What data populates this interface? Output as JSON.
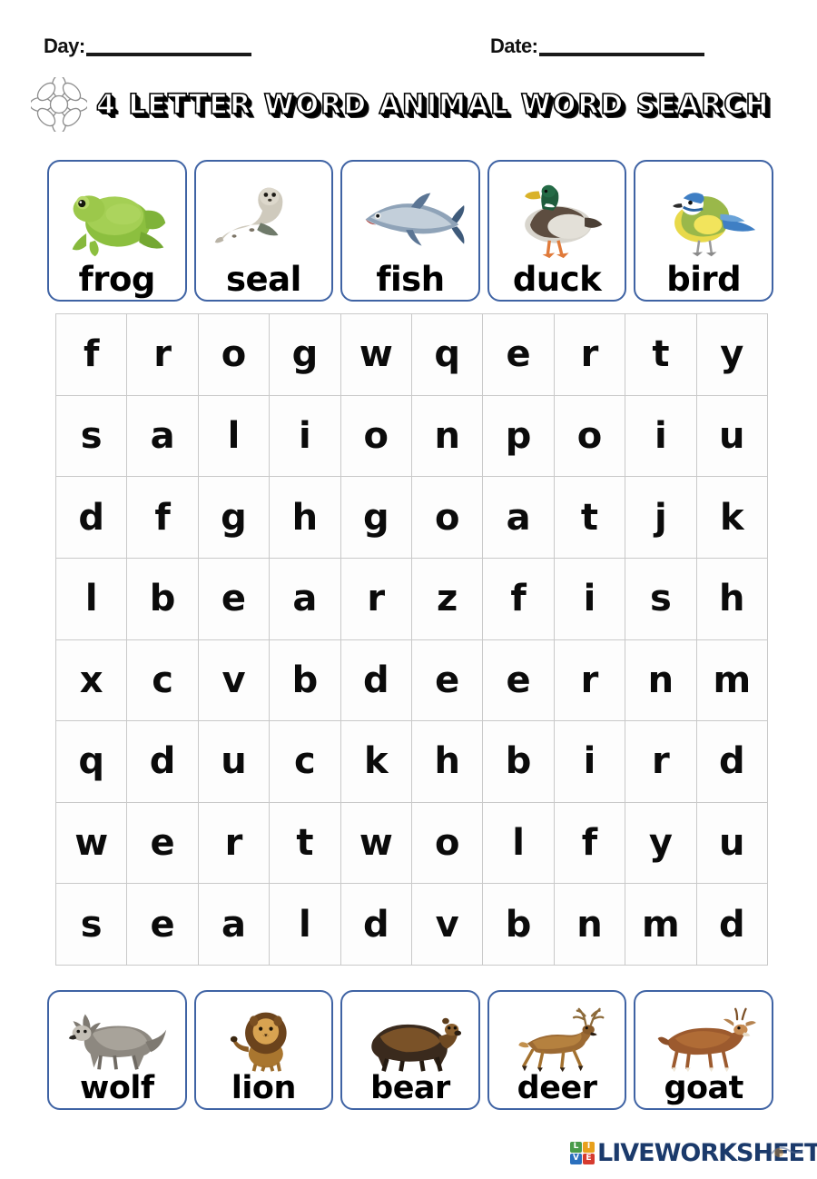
{
  "header": {
    "day_label": "Day:",
    "date_label": "Date:",
    "title": "4 Letter Word Animal Word Search",
    "flower_icon": "flower-icon"
  },
  "top_words": [
    {
      "word": "frog",
      "icon": "frog-photo"
    },
    {
      "word": "seal",
      "icon": "seal-photo"
    },
    {
      "word": "fish",
      "icon": "fish-photo"
    },
    {
      "word": "duck",
      "icon": "duck-photo"
    },
    {
      "word": "bird",
      "icon": "bird-photo"
    }
  ],
  "bottom_words": [
    {
      "word": "wolf",
      "icon": "wolf-photo"
    },
    {
      "word": "lion",
      "icon": "lion-photo"
    },
    {
      "word": "bear",
      "icon": "bear-photo"
    },
    {
      "word": "deer",
      "icon": "deer-photo"
    },
    {
      "word": "goat",
      "icon": "goat-photo"
    }
  ],
  "grid": {
    "rows": 8,
    "cols": 10,
    "letters": [
      [
        "f",
        "r",
        "o",
        "g",
        "w",
        "q",
        "e",
        "r",
        "t",
        "y"
      ],
      [
        "s",
        "a",
        "l",
        "i",
        "o",
        "n",
        "p",
        "o",
        "i",
        "u"
      ],
      [
        "d",
        "f",
        "g",
        "h",
        "g",
        "o",
        "a",
        "t",
        "j",
        "k"
      ],
      [
        "l",
        "b",
        "e",
        "a",
        "r",
        "z",
        "f",
        "i",
        "s",
        "h"
      ],
      [
        "x",
        "c",
        "v",
        "b",
        "d",
        "e",
        "e",
        "r",
        "n",
        "m"
      ],
      [
        "q",
        "d",
        "u",
        "c",
        "k",
        "h",
        "b",
        "i",
        "r",
        "d"
      ],
      [
        "w",
        "e",
        "r",
        "t",
        "w",
        "o",
        "l",
        "f",
        "y",
        "u"
      ],
      [
        "s",
        "e",
        "a",
        "l",
        "d",
        "v",
        "b",
        "n",
        "m",
        "d"
      ]
    ]
  },
  "footer": {
    "logo_text": "LIVEWORKSHEETS",
    "logo_tiles": [
      {
        "letter": "L",
        "color": "#4a9b4a"
      },
      {
        "letter": "I",
        "color": "#e8a01c"
      },
      {
        "letter": "V",
        "color": "#2a6fbd"
      },
      {
        "letter": "E",
        "color": "#d63b2f"
      }
    ]
  },
  "colors": {
    "card_border": "#3f63a4",
    "grid_border": "#c9c9c9",
    "logo_navy": "#1b3a6b",
    "text": "#000000",
    "background": "#ffffff"
  }
}
